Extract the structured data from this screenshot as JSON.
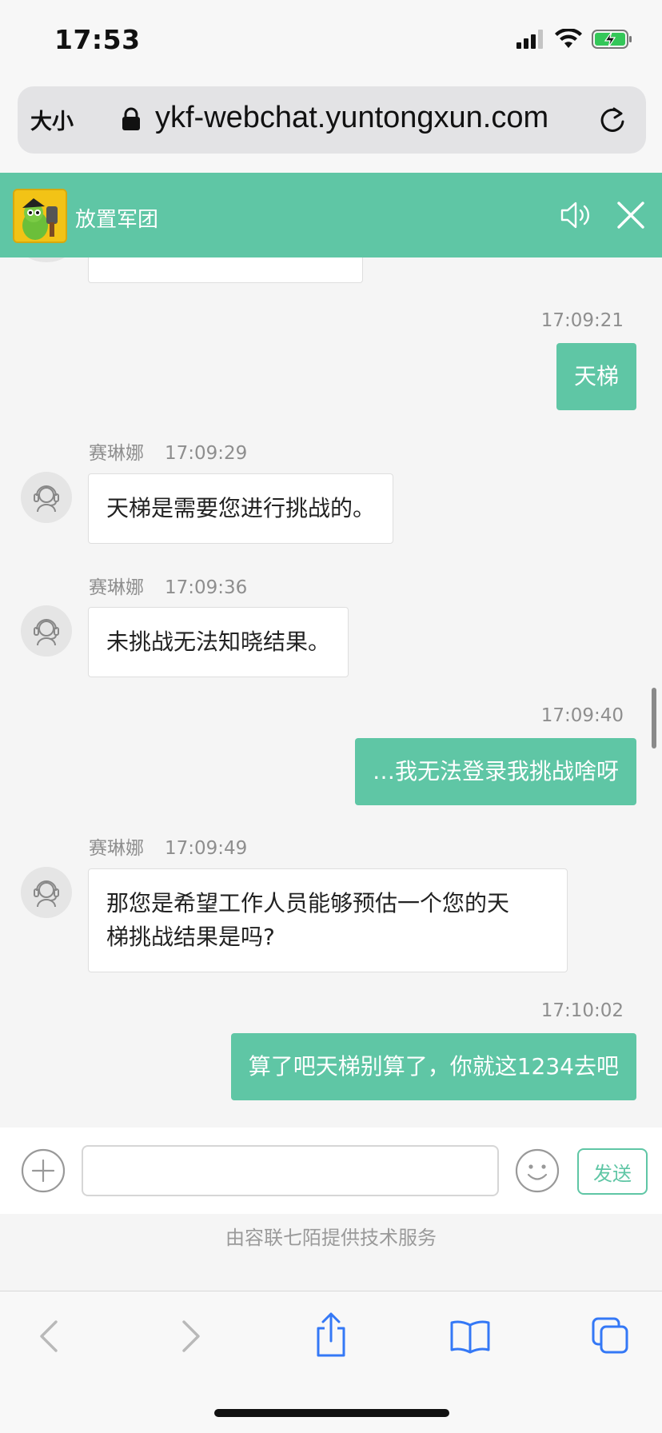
{
  "status_bar": {
    "time": "17:53"
  },
  "browser": {
    "aa_label": "大小",
    "url": "ykf-webchat.yuntongxun.com"
  },
  "chat_header": {
    "title": "放置军团"
  },
  "messages": [
    {
      "side": "user",
      "time": "17:09:21",
      "text": "天梯"
    },
    {
      "side": "agent",
      "name": "赛琳娜",
      "time": "17:09:29",
      "text": "天梯是需要您进行挑战的。"
    },
    {
      "side": "agent",
      "name": "赛琳娜",
      "time": "17:09:36",
      "text": "未挑战无法知晓结果。"
    },
    {
      "side": "user",
      "time": "17:09:40",
      "text": "…我无法登录我挑战啥呀"
    },
    {
      "side": "agent",
      "name": "赛琳娜",
      "time": "17:09:49",
      "text_line1": "那您是希望工作人员能够预估一个您的天",
      "text_line2": "梯挑战结果是吗?"
    },
    {
      "side": "user",
      "time": "17:10:02",
      "text": "算了吧天梯别算了，你就这1234去吧"
    }
  ],
  "input_bar": {
    "placeholder": "",
    "send_label": "发送"
  },
  "footer": {
    "text": "由容联七陌提供技术服务"
  },
  "colors": {
    "accent": "#5fc6a5",
    "safari_blue": "#3478f6"
  }
}
